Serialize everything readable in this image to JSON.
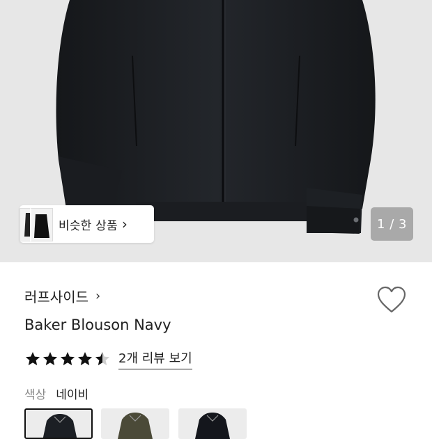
{
  "similar": {
    "label": "비슷한 상품",
    "chevron": "chevron-right-icon"
  },
  "gallery": {
    "counter": "1 / 3"
  },
  "product": {
    "brand": "러프사이드",
    "brand_chevron": "chevron-right-icon",
    "title": "Baker Blouson Navy",
    "rating": 4.5,
    "reviews_link": "2개 리뷰 보기"
  },
  "options": {
    "color_label": "색상",
    "color_value": "네이비",
    "swatches": [
      {
        "name": "navy",
        "color": "#1c1f24",
        "selected": true
      },
      {
        "name": "olive",
        "color": "#4b4a38",
        "selected": false
      },
      {
        "name": "black",
        "color": "#14161c",
        "selected": false
      }
    ]
  },
  "colors": {
    "hero_bg": "#e7e7e7",
    "counter_bg": "#a9a9a9",
    "text": "#222222"
  }
}
